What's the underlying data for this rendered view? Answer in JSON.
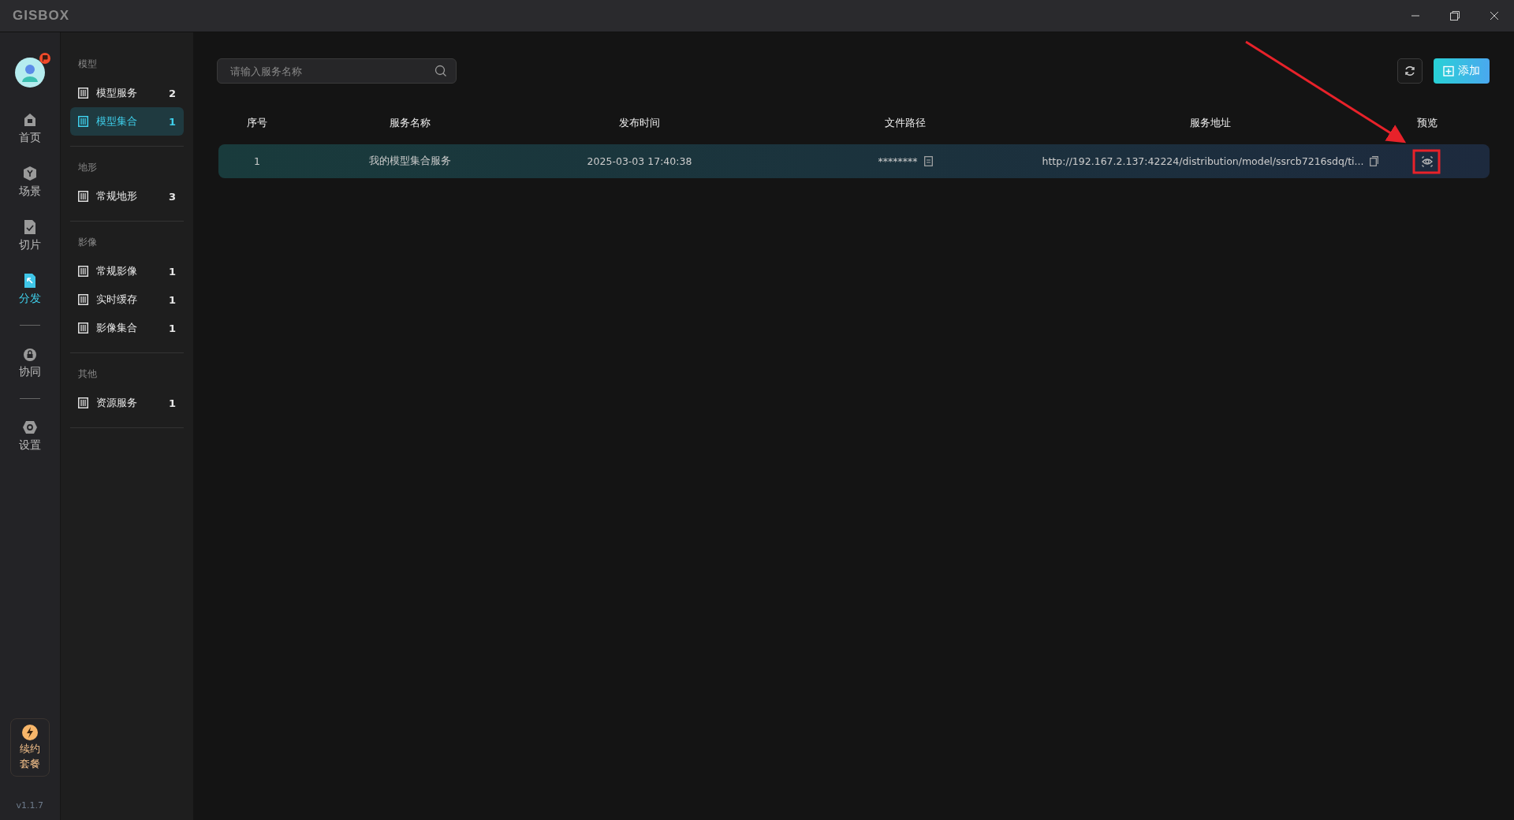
{
  "app": {
    "logo": "GISBOX",
    "version": "v1.1.7"
  },
  "nav_groups": [
    [
      {
        "label": "首页",
        "selected": false
      },
      {
        "label": "场景",
        "selected": false
      },
      {
        "label": "切片",
        "selected": false
      },
      {
        "label": "分发",
        "selected": true
      }
    ],
    [
      {
        "label": "协同",
        "selected": false
      }
    ],
    [
      {
        "label": "设置",
        "selected": false
      }
    ]
  ],
  "renew": {
    "lines": [
      "续约",
      "套餐"
    ]
  },
  "sidebar": [
    {
      "title": "模型",
      "items": [
        {
          "label": "模型服务",
          "count": "2",
          "selected": false
        },
        {
          "label": "模型集合",
          "count": "1",
          "selected": true
        }
      ]
    },
    {
      "title": "地形",
      "items": [
        {
          "label": "常规地形",
          "count": "3",
          "selected": false
        }
      ]
    },
    {
      "title": "影像",
      "items": [
        {
          "label": "常规影像",
          "count": "1",
          "selected": false
        },
        {
          "label": "实时缓存",
          "count": "1",
          "selected": false
        },
        {
          "label": "影像集合",
          "count": "1",
          "selected": false
        }
      ]
    },
    {
      "title": "其他",
      "items": [
        {
          "label": "资源服务",
          "count": "1",
          "selected": false
        }
      ]
    }
  ],
  "search": {
    "placeholder": "请输入服务名称"
  },
  "add_button": "添加",
  "table": {
    "columns": [
      "序号",
      "服务名称",
      "发布时间",
      "文件路径",
      "服务地址",
      "预览"
    ],
    "rows": [
      {
        "index": "1",
        "name": "我的模型集合服务",
        "time": "2025-03-03 17:40:38",
        "path": "********",
        "url": "http://192.167.2.137:42224/distribution/model/ssrcb7216sdq/ti..."
      }
    ]
  }
}
